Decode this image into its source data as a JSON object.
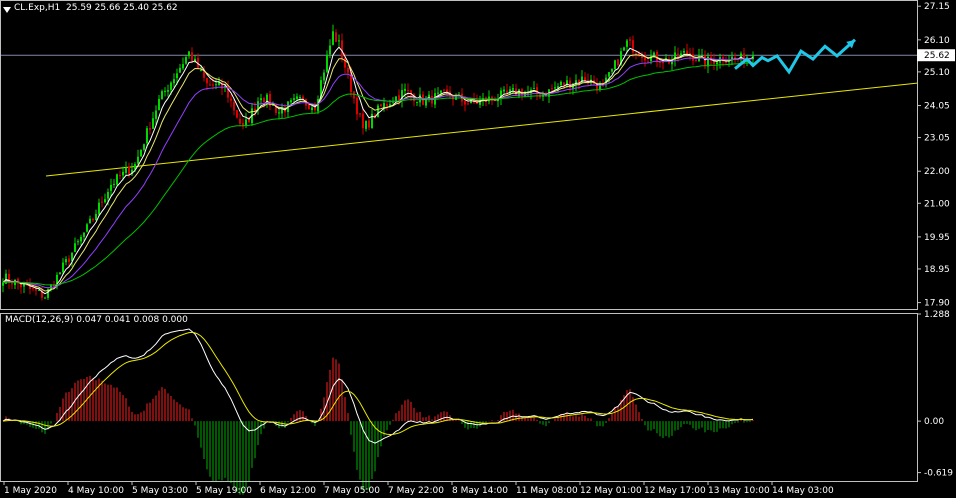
{
  "header": {
    "symbol": "CL.Exp,H1",
    "ohlc": "25.59 25.66 25.40 25.62",
    "macd_title": "MACD(12,26,9) 0.047 0.041 0.008 0.000"
  },
  "current_price_label": "25.62",
  "colors": {
    "background": "#000000",
    "bull": "#00d800",
    "bear": "#d80000",
    "grid_frame": "#c0c0c0",
    "ema_fast": "#ffffff",
    "ema_mid": "#e8e870",
    "ema_slow": "#9040ff",
    "ema_long": "#00c000",
    "trendline": "#e8e800",
    "arrows": "#20c8e8",
    "macd_hist_pos": "#ff2020",
    "macd_hist_neg": "#00b000",
    "macd_line": "#ffffff",
    "signal_line": "#e8e800"
  },
  "chart_data": [
    {
      "type": "candlestick",
      "symbol": "CL.Exp",
      "timeframe": "H1",
      "y_ticks": [
        "27.15",
        "26.10",
        "25.10",
        "24.05",
        "23.05",
        "22.00",
        "21.00",
        "19.95",
        "18.95",
        "17.90"
      ],
      "ylim": [
        17.7,
        27.25
      ],
      "x_ticks": [
        "1 May 2020",
        "4 May 10:00",
        "5 May 03:00",
        "5 May 19:00",
        "6 May 12:00",
        "7 May 05:00",
        "7 May 22:00",
        "8 May 14:00",
        "11 May 08:00",
        "12 May 01:00",
        "12 May 17:00",
        "13 May 10:00",
        "14 May 03:00"
      ],
      "anchors": [
        [
          0,
          18.7
        ],
        [
          8,
          18.35
        ],
        [
          14,
          18.1
        ],
        [
          20,
          19.0
        ],
        [
          28,
          20.2
        ],
        [
          36,
          21.6
        ],
        [
          44,
          22.2
        ],
        [
          52,
          24.2
        ],
        [
          58,
          25.1
        ],
        [
          62,
          25.7
        ],
        [
          68,
          24.7
        ],
        [
          74,
          24.6
        ],
        [
          80,
          23.3
        ],
        [
          86,
          24.4
        ],
        [
          92,
          23.85
        ],
        [
          98,
          24.2
        ],
        [
          104,
          24.05
        ],
        [
          110,
          26.3
        ],
        [
          112,
          25.95
        ],
        [
          116,
          24.6
        ],
        [
          120,
          23.3
        ],
        [
          126,
          24.0
        ],
        [
          134,
          24.5
        ],
        [
          140,
          24.2
        ],
        [
          148,
          24.4
        ],
        [
          156,
          24.1
        ],
        [
          164,
          24.3
        ],
        [
          172,
          24.5
        ],
        [
          180,
          24.4
        ],
        [
          186,
          24.7
        ],
        [
          194,
          24.9
        ],
        [
          200,
          24.6
        ],
        [
          208,
          26.0
        ],
        [
          214,
          25.6
        ],
        [
          222,
          25.45
        ],
        [
          228,
          25.7
        ],
        [
          234,
          25.4
        ],
        [
          240,
          25.55
        ],
        [
          246,
          25.5
        ],
        [
          250,
          25.6
        ]
      ],
      "last_close": 25.62,
      "indicators": [
        "EMA fast",
        "EMA mid",
        "EMA slow",
        "EMA long"
      ],
      "trendline": {
        "from": [
          0,
          21.85
        ],
        "to": [
          325,
          24.75
        ]
      },
      "forecast_arrows": [
        [
          244,
          25.2
        ],
        [
          248,
          25.5
        ],
        [
          250,
          25.3
        ],
        [
          253,
          25.55
        ],
        [
          255,
          25.45
        ],
        [
          258,
          25.6
        ],
        [
          262,
          25.1
        ],
        [
          266,
          25.75
        ],
        [
          270,
          25.5
        ],
        [
          274,
          25.9
        ],
        [
          278,
          25.6
        ],
        [
          284,
          26.1
        ]
      ]
    },
    {
      "type": "bar",
      "name": "MACD",
      "params": "12,26,9",
      "y_ticks": [
        "1.288",
        "0.00",
        "-0.619"
      ],
      "ylim": [
        -0.72,
        1.3
      ]
    }
  ]
}
